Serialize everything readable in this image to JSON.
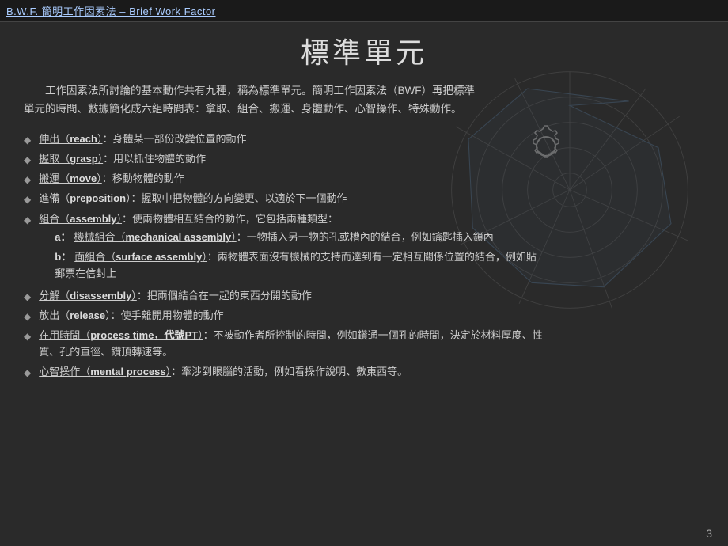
{
  "nav": {
    "title": "B.W.F. 簡明工作因素法 – Brief Work Factor"
  },
  "page": {
    "title": "標準單元",
    "intro": "工作因素法所討論的基本動作共有九種，稱為標準單元。簡明工作因素法（BWF）再把標準單元的時間、數據簡化成六組時間表：拿取、組合、搬運、身體動作、心智操作、特殊動作。",
    "page_number": "3"
  },
  "bullets": [
    {
      "term_zh": "伸出（",
      "term_en": "reach",
      "term_zh2": "）",
      "desc": "：身體某一部份改變位置的動作"
    },
    {
      "term_zh": "握取（",
      "term_en": "grasp",
      "term_zh2": "）",
      "desc": "：用以抓住物體的動作"
    },
    {
      "term_zh": "搬運（",
      "term_en": "move",
      "term_zh2": "）",
      "desc": "：移動物體的動作"
    },
    {
      "term_zh": "進備（",
      "term_en": "preposition",
      "term_zh2": "）",
      "desc": "：握取中把物體的方向變更、以適於下一個動作"
    },
    {
      "term_zh": "組合（",
      "term_en": "assembly",
      "term_zh2": "）",
      "desc": "：使兩物體相互結合的動作，它包括兩種類型：",
      "has_sub": true,
      "sub_a_label": "a：",
      "sub_a_term": "機械組合（mechanical assembly）",
      "sub_a_desc": "：一物插入另一物的孔或槽內的結合，例如鑰匙插入鎖內",
      "sub_b_label": "b：",
      "sub_b_term": "面組合（surface assembly）",
      "sub_b_desc": "：兩物體表面沒有機械的支持而達到有一定相互關係位置的結合，例如貼郵票在信封上"
    },
    {
      "term_zh": "分解（",
      "term_en": "disassembly",
      "term_zh2": "）",
      "desc": "：把兩個結合在一起的東西分開的動作"
    },
    {
      "term_zh": "放出（",
      "term_en": "release",
      "term_zh2": "）",
      "desc": "：使手離開用物體的動作"
    },
    {
      "term_zh": "在用時間（",
      "term_en": "process time，代號PT",
      "term_zh2": "）",
      "desc": "：不被動作者所控制的時間，例如鑽通一個孔的時間，決定於材料厚度、性質、孔的直徑、鑽頂轉速等。"
    },
    {
      "term_zh": "心智操作（",
      "term_en": "mental process",
      "term_zh2": "）",
      "desc": "：牽涉到眼腦的活動，例如看操作說明、數東西等。"
    }
  ]
}
